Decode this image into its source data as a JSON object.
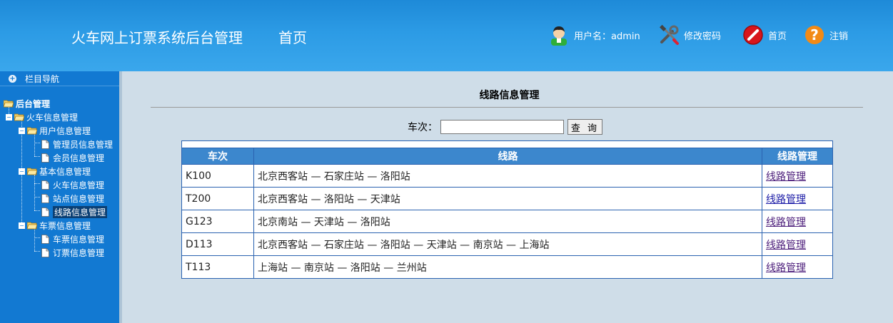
{
  "header": {
    "title": "火车网上订票系统后台管理",
    "home": "首页",
    "user_label": "用户名：admin",
    "change_password": "修改密码",
    "home_link": "首页",
    "logout": "注销"
  },
  "sidebar": {
    "nav_title": "栏目导航",
    "tree": {
      "root": "后台管理",
      "train_info": "火车信息管理",
      "user_info": "用户信息管理",
      "admin_info": "管理员信息管理",
      "member_info": "会员信息管理",
      "basic_info": "基本信息管理",
      "train_mgmt": "火车信息管理",
      "station_mgmt": "站点信息管理",
      "route_mgmt": "线路信息管理",
      "ticket_info": "车票信息管理",
      "ticket_mgmt": "车票信息管理",
      "booking_mgmt": "订票信息管理"
    }
  },
  "main": {
    "page_title": "线路信息管理",
    "search_label": "车次：",
    "search_value": "",
    "search_button": "查 询",
    "columns": [
      "车次",
      "线路",
      "线路管理"
    ],
    "rows": [
      {
        "train": "K100",
        "route": "北京西客站 — 石家庄站 — 洛阳站",
        "action": "线路管理"
      },
      {
        "train": "T200",
        "route": "北京西客站 — 洛阳站 — 天津站",
        "action": "线路管理"
      },
      {
        "train": "G123",
        "route": "北京南站 — 天津站 — 洛阳站",
        "action": "线路管理"
      },
      {
        "train": "D113",
        "route": "北京西客站 — 石家庄站 — 洛阳站 — 天津站 — 南京站 — 上海站",
        "action": "线路管理"
      },
      {
        "train": "T113",
        "route": "上海站 — 南京站 — 洛阳站 — 兰州站",
        "action": "线路管理"
      }
    ]
  },
  "colors": {
    "header_blue": "#2c9be5",
    "sidebar_blue": "#1279d2",
    "table_header": "#3c87cd",
    "table_border": "#2a62b0",
    "content_bg": "#cfdde8"
  }
}
